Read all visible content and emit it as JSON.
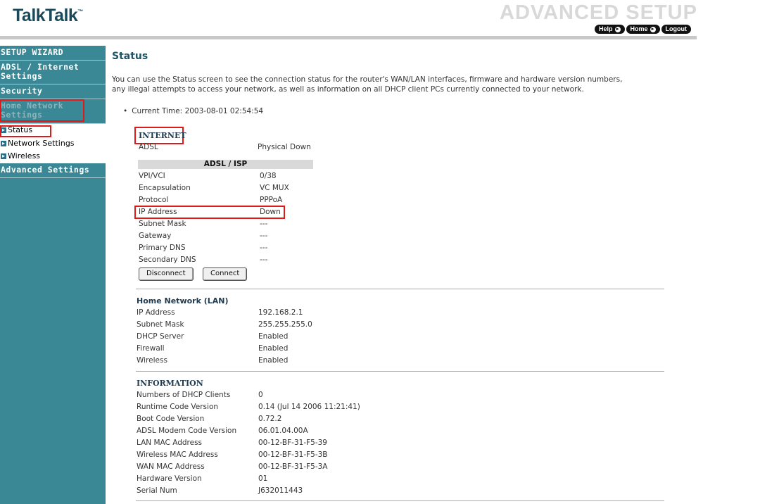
{
  "brand": {
    "logo_text": "TalkTalk",
    "logo_tm": "™",
    "banner_title": "ADVANCED SETUP"
  },
  "top_nav": [
    {
      "label": "Help"
    },
    {
      "label": "Home"
    },
    {
      "label": "Logout"
    }
  ],
  "sidebar": {
    "items": [
      {
        "label": "SETUP WIZARD"
      },
      {
        "label": "ADSL / Internet Settings"
      },
      {
        "label": "Security"
      },
      {
        "label": "Home Network Settings"
      },
      {
        "label": "Advanced Settings"
      }
    ],
    "sub_items": [
      {
        "label": "Status"
      },
      {
        "label": "Network Settings"
      },
      {
        "label": "Wireless"
      }
    ]
  },
  "page": {
    "title": "Status",
    "intro_line1": "You can use the Status screen to see the connection status for the router's WAN/LAN interfaces, firmware and hardware version numbers,",
    "intro_line2": "any illegal attempts to access your network, as well as information on all DHCP client PCs currently connected to your network.",
    "current_time_label": "Current Time:",
    "current_time_value": "2003-08-01 02:54:54"
  },
  "internet": {
    "heading": "INTERNET",
    "adsl_label": "ADSL",
    "adsl_value": "Physical Down",
    "isp_band": "ADSL / ISP",
    "rows": [
      {
        "label": "VPI/VCI",
        "value": "0/38"
      },
      {
        "label": "Encapsulation",
        "value": "VC MUX"
      },
      {
        "label": "Protocol",
        "value": "PPPoA"
      },
      {
        "label": "IP Address",
        "value": "Down"
      },
      {
        "label": "Subnet Mask",
        "value": "---"
      },
      {
        "label": "Gateway",
        "value": "---"
      },
      {
        "label": "Primary DNS",
        "value": "---"
      },
      {
        "label": "Secondary DNS",
        "value": "---"
      }
    ],
    "disconnect_label": "Disconnect",
    "connect_label": "Connect"
  },
  "lan": {
    "heading": "Home Network (LAN)",
    "rows": [
      {
        "label": "IP Address",
        "value": "192.168.2.1"
      },
      {
        "label": "Subnet Mask",
        "value": "255.255.255.0"
      },
      {
        "label": "DHCP Server",
        "value": "Enabled"
      },
      {
        "label": "Firewall",
        "value": "Enabled"
      },
      {
        "label": "Wireless",
        "value": "Enabled"
      }
    ]
  },
  "information": {
    "heading": "INFORMATION",
    "rows": [
      {
        "label": "Numbers of DHCP Clients",
        "value": "0"
      },
      {
        "label": "Runtime Code Version",
        "value": "0.14 (Jul 14 2006 11:21:41)"
      },
      {
        "label": "Boot Code Version",
        "value": "0.72.2"
      },
      {
        "label": "ADSL Modem Code Version",
        "value": "06.01.04.00A"
      },
      {
        "label": "LAN MAC Address",
        "value": "00-12-BF-31-F5-39"
      },
      {
        "label": "Wireless MAC Address",
        "value": "00-12-BF-31-F5-3B"
      },
      {
        "label": "WAN MAC Address",
        "value": "00-12-BF-31-F5-3A"
      },
      {
        "label": "Hardware Version",
        "value": "01"
      },
      {
        "label": "Serial Num",
        "value": "J632011443"
      }
    ]
  },
  "colors": {
    "sidebar_bg": "#3a8795",
    "highlight": "#dc1a1a",
    "title": "#1e5468"
  }
}
